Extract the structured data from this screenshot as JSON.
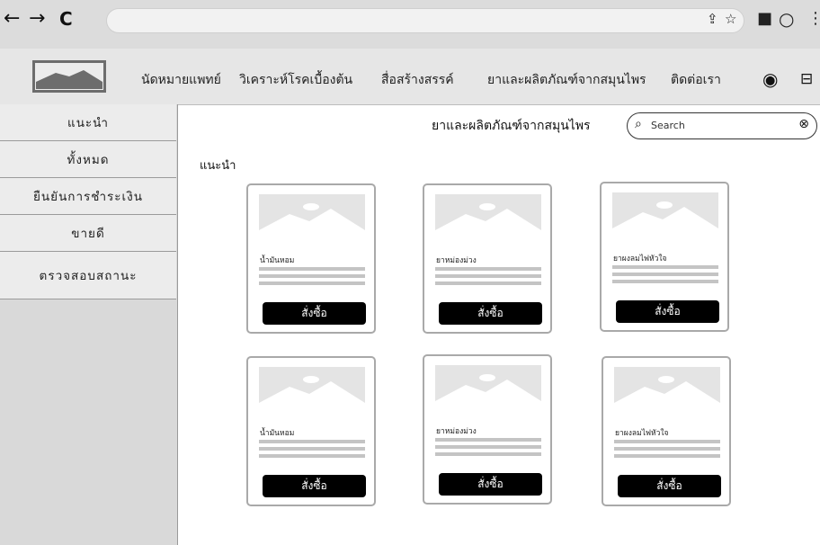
{
  "browser": {
    "back_icon": "←",
    "forward_icon": "→",
    "reload_icon": "C",
    "share_icon": "⇪",
    "star_icon": "☆",
    "panel_icon": "■",
    "profile_icon": "○",
    "menu_icon": "⋮"
  },
  "header": {
    "nav": [
      {
        "label": "นัดหมายแพทย์"
      },
      {
        "label": "วิเคราะห์โรคเบื้องต้น"
      },
      {
        "label": "สื่อสร้างสรรค์"
      },
      {
        "label": "ยาและผลิตภัณฑ์จากสมุนไพร"
      },
      {
        "label": "ติดต่อเรา"
      }
    ],
    "user_icon": "◉",
    "cart_icon": "⊟"
  },
  "sidebar": {
    "items": [
      {
        "label": "แนะนำ"
      },
      {
        "label": "ทั้งหมด"
      },
      {
        "label": "ยืนยันการชำระเงิน"
      },
      {
        "label": "ขายดี"
      },
      {
        "label": "ตรวจสอบสถานะ"
      }
    ]
  },
  "main": {
    "title": "ยาและผลิตภัณฑ์จากสมุนไพร",
    "search": {
      "placeholder": "Search",
      "icon": "⌕",
      "clear_icon": "⊗"
    },
    "section_title": "แนะนำ",
    "products": [
      {
        "name": "น้ำมันหอม",
        "button": "สั่งซื้อ"
      },
      {
        "name": "ยาหม่องม่วง",
        "button": "สั่งซื้อ"
      },
      {
        "name": "ยาผงลมไฟหัวใจ",
        "button": "สั่งซื้อ"
      },
      {
        "name": "น้ำมันหอม",
        "button": "สั่งซื้อ"
      },
      {
        "name": "ยาหม่องม่วง",
        "button": "สั่งซื้อ"
      },
      {
        "name": "ยาผงลมไฟหัวใจ",
        "button": "สั่งซื้อ"
      }
    ]
  }
}
